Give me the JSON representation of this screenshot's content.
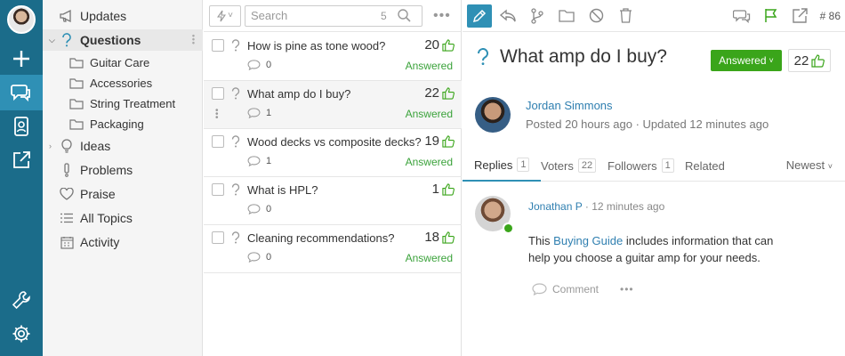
{
  "nav": {
    "updates": "Updates",
    "questions": "Questions",
    "sub": [
      "Guitar Care",
      "Accessories",
      "String Treatment",
      "Packaging"
    ],
    "ideas": "Ideas",
    "problems": "Problems",
    "praise": "Praise",
    "all_topics": "All Topics",
    "activity": "Activity"
  },
  "list": {
    "search_placeholder": "Search",
    "search_count": "5",
    "rows": [
      {
        "title": "How is pine as tone wood?",
        "votes": "20",
        "comments": "0",
        "status": "Answered"
      },
      {
        "title": "What amp do I buy?",
        "votes": "22",
        "comments": "1",
        "status": "Answered"
      },
      {
        "title": "Wood decks vs composite decks?",
        "votes": "19",
        "comments": "1",
        "status": "Answered"
      },
      {
        "title": "What is HPL?",
        "votes": "1",
        "comments": "0",
        "status": ""
      },
      {
        "title": "Cleaning recommendations?",
        "votes": "18",
        "comments": "0",
        "status": "Answered"
      }
    ]
  },
  "detail": {
    "ticket_number": "# 86",
    "title": "What amp do I buy?",
    "status_label": "Answered",
    "votes": "22",
    "author": "Jordan Simmons",
    "posted": "Posted 20 hours ago · Updated 12 minutes ago",
    "tabs": [
      {
        "label": "Replies",
        "count": "1"
      },
      {
        "label": "Voters",
        "count": "22"
      },
      {
        "label": "Followers",
        "count": "1"
      },
      {
        "label": "Related",
        "count": ""
      }
    ],
    "sort": "Newest",
    "reply": {
      "author": "Jonathan P",
      "time": "12 minutes ago",
      "text_before": "This ",
      "link": "Buying Guide",
      "text_after": " includes information that can help you choose a guitar amp for your needs.",
      "comment_label": "Comment"
    }
  },
  "colors": {
    "rail": "#1b6c8a",
    "accent": "#2f90b5",
    "success": "#3aa51a",
    "link": "#2f7fb0"
  }
}
